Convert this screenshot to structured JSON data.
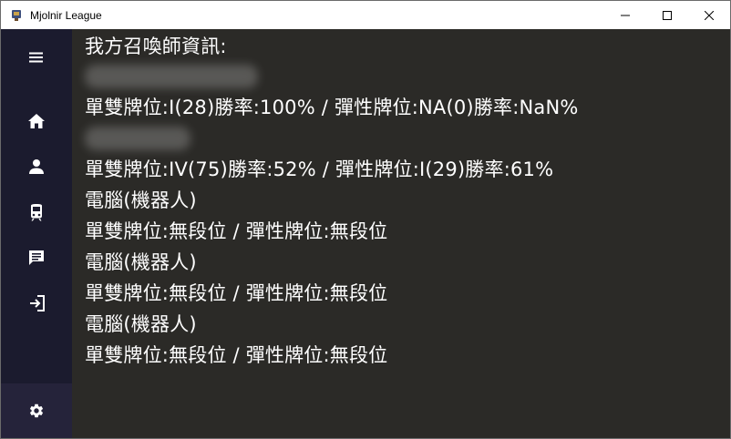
{
  "window": {
    "title": "Mjolnir League"
  },
  "sidebar": {
    "items": [
      {
        "icon": "menu-icon"
      },
      {
        "icon": "home-icon"
      },
      {
        "icon": "person-icon"
      },
      {
        "icon": "train-icon"
      },
      {
        "icon": "chat-icon"
      },
      {
        "icon": "exit-icon"
      }
    ],
    "settings_icon": "gear-icon"
  },
  "content": {
    "heading": "我方召喚師資訊:",
    "players": [
      {
        "name_hidden": true,
        "rank": "單雙牌位:I(28)勝率:100% / 彈性牌位:NA(0)勝率:NaN%"
      },
      {
        "name_hidden": true,
        "rank": "單雙牌位:IV(75)勝率:52% / 彈性牌位:I(29)勝率:61%"
      },
      {
        "name": "電腦(機器人)",
        "rank": "單雙牌位:無段位 / 彈性牌位:無段位"
      },
      {
        "name": "電腦(機器人)",
        "rank": "單雙牌位:無段位 / 彈性牌位:無段位"
      },
      {
        "name": "電腦(機器人)",
        "rank": "單雙牌位:無段位 / 彈性牌位:無段位"
      }
    ]
  },
  "colors": {
    "sidebar": "#1b1b2e",
    "content_bg": "#2b2a27",
    "text": "#ffffff"
  }
}
